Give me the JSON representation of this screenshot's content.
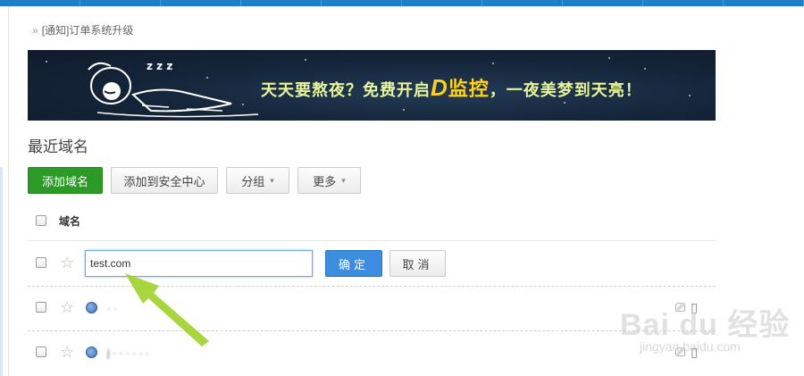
{
  "notice": {
    "chevron": "»",
    "text": "[通知]订单系统升级"
  },
  "banner": {
    "slogan_part1": "天天要熬夜？免费开启",
    "slogan_brand_d": "D",
    "slogan_brand": "监控",
    "slogan_part2": "，一夜美梦到天亮！",
    "sleep_text": "z z z",
    "bg_color": "#142438",
    "slogan_color": "#e7f59a",
    "brand_color": "#ffd21f"
  },
  "section": {
    "title": "最近域名"
  },
  "toolbar": {
    "add_domain": "添加域名",
    "add_security": "添加到安全中心",
    "group": "分组",
    "more": "更多",
    "caret": "▾",
    "accent_green": "#2b9a26"
  },
  "table": {
    "header_domain": "域名",
    "new_row": {
      "input_value": "test.com",
      "confirm": "确定",
      "cancel": "取消",
      "accent_blue": "#3c8de0"
    },
    "rows": [
      {
        "domain_obscured": "· ·"
      },
      {
        "domain_obscured": "j · ·  ·  ·  · ·"
      }
    ]
  },
  "icons": {
    "star": "star-icon",
    "globe": "globe-icon",
    "monitor": "monitor-icon",
    "lock": "lock-icon"
  },
  "watermark": {
    "main": "Bai du 经验",
    "sub": "jingyan.baidu.com"
  }
}
